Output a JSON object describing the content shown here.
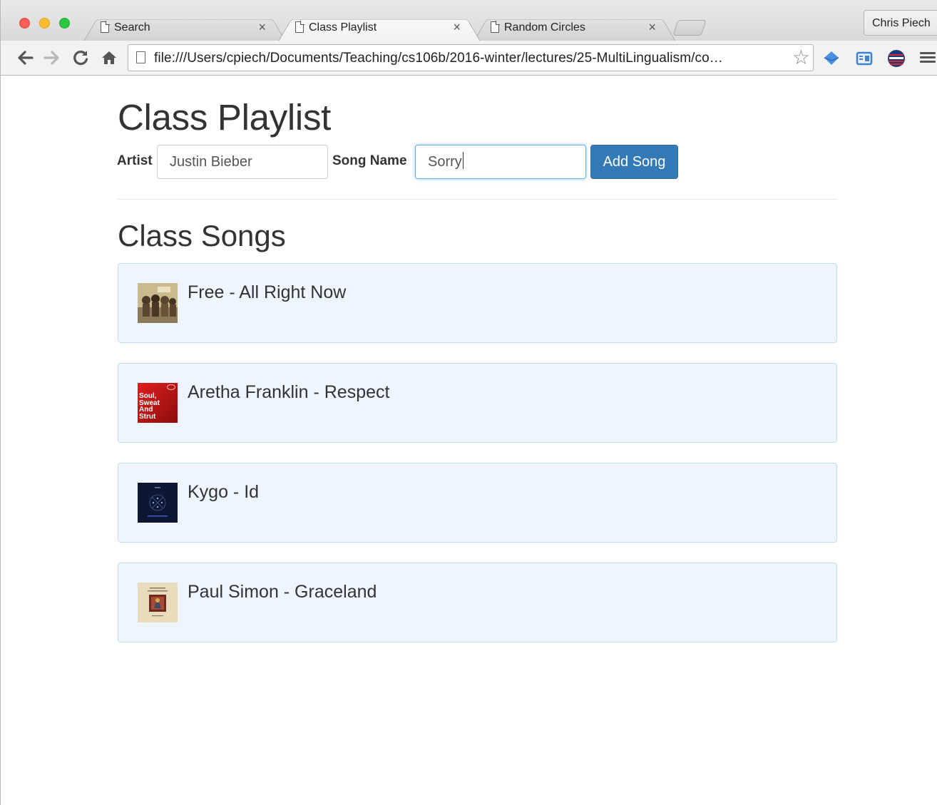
{
  "browser": {
    "tabs": [
      {
        "label": "Search",
        "active": false
      },
      {
        "label": "Class Playlist",
        "active": true
      },
      {
        "label": "Random Circles",
        "active": false
      }
    ],
    "tab_close_glyph": "×",
    "profile_name": "Chris Piech",
    "url": "file:///Users/cpiech/Documents/Teaching/cs106b/2016-winter/lectures/25-MultiLingualism/co…",
    "icons": [
      "back-arrow-icon",
      "forward-arrow-icon",
      "reload-icon",
      "home-icon",
      "page-icon",
      "bookmark-star-icon",
      "extension-icon",
      "cast-icon",
      "flag-badge-icon",
      "hamburger-menu-icon"
    ]
  },
  "page": {
    "title": "Class Playlist",
    "form": {
      "artist_label": "Artist",
      "artist_value": "Justin Bieber",
      "song_label": "Song Name",
      "song_value": "Sorry",
      "add_button": "Add Song"
    },
    "songs_heading": "Class Songs",
    "songs": [
      {
        "title": "Free - All Right Now",
        "art": "free-album-art"
      },
      {
        "title": "Aretha Franklin - Respect",
        "art": "soul-sweat-strut-album-art",
        "art_text": [
          "Soul,",
          "Sweat",
          "And",
          "Strut"
        ]
      },
      {
        "title": "Kygo - Id",
        "art": "kygo-album-art"
      },
      {
        "title": "Paul Simon - Graceland",
        "art": "graceland-album-art"
      }
    ]
  },
  "colors": {
    "primary_button": "#337ab7",
    "song_card_bg": "#eff5fe",
    "song_card_border": "#bce0ee",
    "focus_ring": "#66afe9"
  }
}
